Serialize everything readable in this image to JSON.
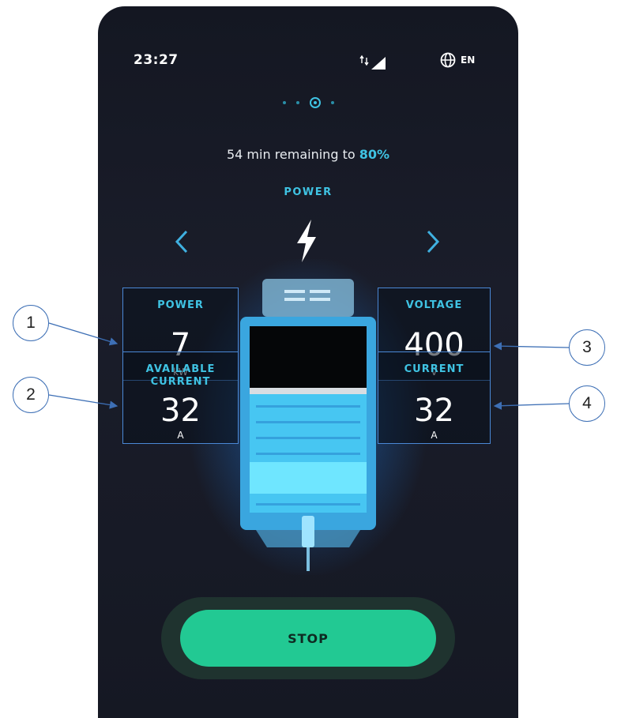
{
  "status_bar": {
    "time": "23:27",
    "language": "EN"
  },
  "pager": {
    "count": 4,
    "active_index": 2
  },
  "charging": {
    "remaining_prefix": "54 min remaining to",
    "target_percent": "80%",
    "mode_title": "POWER"
  },
  "metrics": {
    "power": {
      "label": "POWER",
      "value": "7",
      "unit": "kW"
    },
    "available_current": {
      "label_line1": "AVAILABLE",
      "label_line2": "CURRENT",
      "value": "32",
      "unit": "A"
    },
    "voltage": {
      "label": "VOLTAGE",
      "value": "400",
      "unit": "V"
    },
    "current": {
      "label": "CURRENT",
      "value": "32",
      "unit": "A"
    }
  },
  "actions": {
    "stop_label": "STOP"
  },
  "callouts": [
    "1",
    "2",
    "3",
    "4"
  ],
  "colors": {
    "accent": "#3fc3e3",
    "stop_button": "#22c993",
    "box_border": "#4a88d6",
    "background": "#161923"
  },
  "icons": [
    "signal-icon",
    "globe-icon",
    "chevron-left-icon",
    "lightning-bolt-icon",
    "chevron-right-icon"
  ]
}
